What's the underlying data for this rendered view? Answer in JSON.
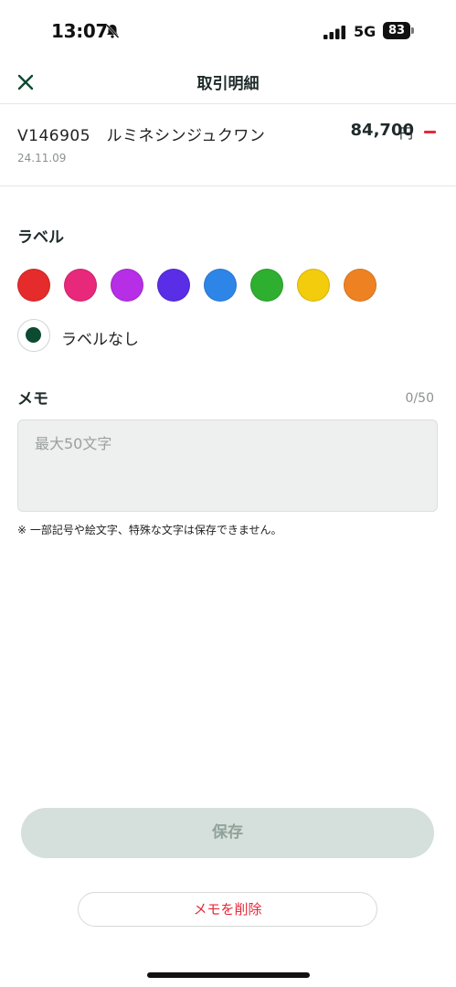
{
  "status_bar": {
    "time": "13:07",
    "network": "5G",
    "battery": "83",
    "icons": [
      "bell-muted-icon",
      "signal-icon"
    ]
  },
  "header": {
    "title": "取引明細",
    "close_icon": "close-icon"
  },
  "transaction": {
    "name": "V146905　ルミネシンジュクワン",
    "amount": "84,700",
    "currency": "円",
    "sign_icon": "minus-icon",
    "date": "24.11.09"
  },
  "label_section": {
    "title": "ラベル",
    "colors": [
      {
        "name": "red",
        "hex": "#e52b2b"
      },
      {
        "name": "pink",
        "hex": "#e8287a"
      },
      {
        "name": "purple",
        "hex": "#b62ee6"
      },
      {
        "name": "indigo",
        "hex": "#5a2de6"
      },
      {
        "name": "blue",
        "hex": "#2e85e8"
      },
      {
        "name": "green",
        "hex": "#2faf2f"
      },
      {
        "name": "yellow",
        "hex": "#f3cc0d"
      },
      {
        "name": "orange",
        "hex": "#ee8222"
      }
    ],
    "no_label_text": "ラベルなし",
    "selected": "ラベルなし",
    "selected_color": "#0d4a32"
  },
  "memo": {
    "title": "メモ",
    "counter": "0/50",
    "value": "",
    "placeholder": "最大50文字",
    "notice": "※ 一部記号や絵文字、特殊な文字は保存できません。"
  },
  "actions": {
    "save_label": "保存",
    "delete_label": "メモを削除"
  },
  "colors": {
    "accent": "#0d4a32",
    "danger": "#e8283a",
    "save_disabled_bg": "#d5dfdb"
  }
}
